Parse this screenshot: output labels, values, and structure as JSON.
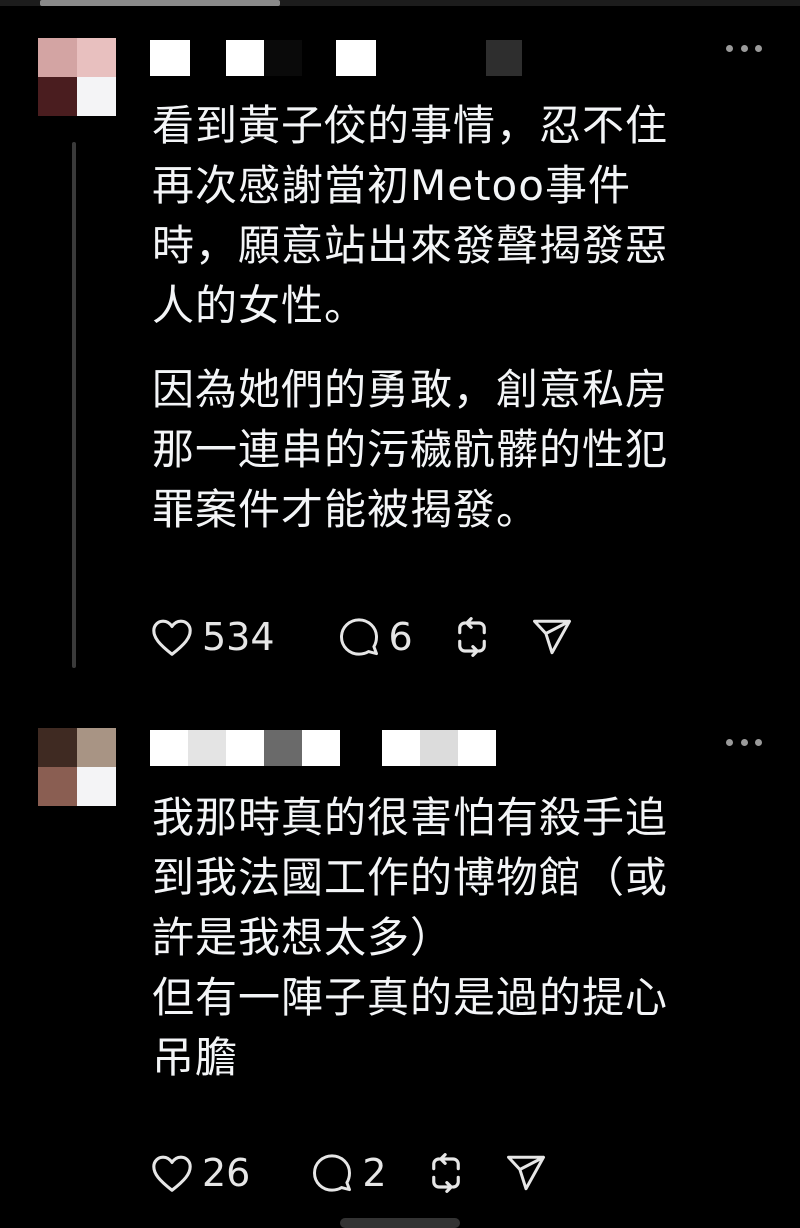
{
  "posts": [
    {
      "paragraphs": [
        "看到黃子佼的事情，忍不住再次感謝當初Metoo事件時，願意站出來發聲揭發惡人的女性。",
        "因為她們的勇敢，創意私房那一連串的污穢骯髒的性犯罪案件才能被揭發。"
      ],
      "lines_p1": [
        "看到黃子佼的事情，忍不住",
        "再次感謝當初Metoo事件",
        "時，願意站出來發聲揭發惡",
        "人的女性。"
      ],
      "lines_p2": [
        "因為她們的勇敢，創意私房",
        "那一連串的污穢骯髒的性犯",
        "罪案件才能被揭發。"
      ],
      "likes": "534",
      "replies": "6",
      "icons": [
        "heart-icon",
        "comment-icon",
        "repost-icon",
        "share-icon",
        "more-icon"
      ]
    },
    {
      "lines": [
        "我那時真的很害怕有殺手追",
        "到我法國工作的博物館（或",
        "許是我想太多）",
        "但有一陣子真的是過的提心",
        "吊膽"
      ],
      "likes": "26",
      "replies": "2",
      "icons": [
        "heart-icon",
        "comment-icon",
        "repost-icon",
        "share-icon",
        "more-icon"
      ]
    }
  ],
  "colors": {
    "background": "#000000",
    "text": "#f3f5f7",
    "icon": "#e6e6e6",
    "thread_line": "#3a3a3a"
  }
}
